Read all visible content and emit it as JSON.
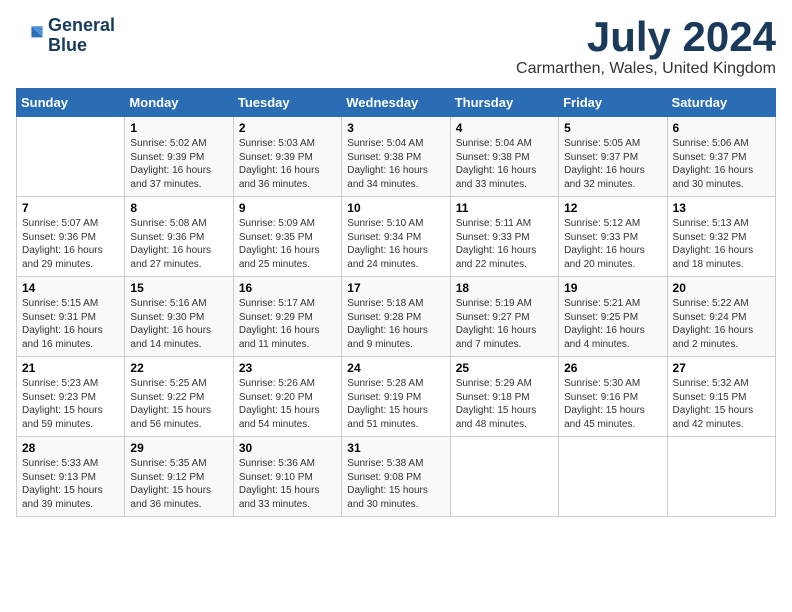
{
  "header": {
    "logo_line1": "General",
    "logo_line2": "Blue",
    "month": "July 2024",
    "location": "Carmarthen, Wales, United Kingdom"
  },
  "weekdays": [
    "Sunday",
    "Monday",
    "Tuesday",
    "Wednesday",
    "Thursday",
    "Friday",
    "Saturday"
  ],
  "weeks": [
    [
      {
        "day": "",
        "info": ""
      },
      {
        "day": "1",
        "info": "Sunrise: 5:02 AM\nSunset: 9:39 PM\nDaylight: 16 hours\nand 37 minutes."
      },
      {
        "day": "2",
        "info": "Sunrise: 5:03 AM\nSunset: 9:39 PM\nDaylight: 16 hours\nand 36 minutes."
      },
      {
        "day": "3",
        "info": "Sunrise: 5:04 AM\nSunset: 9:38 PM\nDaylight: 16 hours\nand 34 minutes."
      },
      {
        "day": "4",
        "info": "Sunrise: 5:04 AM\nSunset: 9:38 PM\nDaylight: 16 hours\nand 33 minutes."
      },
      {
        "day": "5",
        "info": "Sunrise: 5:05 AM\nSunset: 9:37 PM\nDaylight: 16 hours\nand 32 minutes."
      },
      {
        "day": "6",
        "info": "Sunrise: 5:06 AM\nSunset: 9:37 PM\nDaylight: 16 hours\nand 30 minutes."
      }
    ],
    [
      {
        "day": "7",
        "info": "Sunrise: 5:07 AM\nSunset: 9:36 PM\nDaylight: 16 hours\nand 29 minutes."
      },
      {
        "day": "8",
        "info": "Sunrise: 5:08 AM\nSunset: 9:36 PM\nDaylight: 16 hours\nand 27 minutes."
      },
      {
        "day": "9",
        "info": "Sunrise: 5:09 AM\nSunset: 9:35 PM\nDaylight: 16 hours\nand 25 minutes."
      },
      {
        "day": "10",
        "info": "Sunrise: 5:10 AM\nSunset: 9:34 PM\nDaylight: 16 hours\nand 24 minutes."
      },
      {
        "day": "11",
        "info": "Sunrise: 5:11 AM\nSunset: 9:33 PM\nDaylight: 16 hours\nand 22 minutes."
      },
      {
        "day": "12",
        "info": "Sunrise: 5:12 AM\nSunset: 9:33 PM\nDaylight: 16 hours\nand 20 minutes."
      },
      {
        "day": "13",
        "info": "Sunrise: 5:13 AM\nSunset: 9:32 PM\nDaylight: 16 hours\nand 18 minutes."
      }
    ],
    [
      {
        "day": "14",
        "info": "Sunrise: 5:15 AM\nSunset: 9:31 PM\nDaylight: 16 hours\nand 16 minutes."
      },
      {
        "day": "15",
        "info": "Sunrise: 5:16 AM\nSunset: 9:30 PM\nDaylight: 16 hours\nand 14 minutes."
      },
      {
        "day": "16",
        "info": "Sunrise: 5:17 AM\nSunset: 9:29 PM\nDaylight: 16 hours\nand 11 minutes."
      },
      {
        "day": "17",
        "info": "Sunrise: 5:18 AM\nSunset: 9:28 PM\nDaylight: 16 hours\nand 9 minutes."
      },
      {
        "day": "18",
        "info": "Sunrise: 5:19 AM\nSunset: 9:27 PM\nDaylight: 16 hours\nand 7 minutes."
      },
      {
        "day": "19",
        "info": "Sunrise: 5:21 AM\nSunset: 9:25 PM\nDaylight: 16 hours\nand 4 minutes."
      },
      {
        "day": "20",
        "info": "Sunrise: 5:22 AM\nSunset: 9:24 PM\nDaylight: 16 hours\nand 2 minutes."
      }
    ],
    [
      {
        "day": "21",
        "info": "Sunrise: 5:23 AM\nSunset: 9:23 PM\nDaylight: 15 hours\nand 59 minutes."
      },
      {
        "day": "22",
        "info": "Sunrise: 5:25 AM\nSunset: 9:22 PM\nDaylight: 15 hours\nand 56 minutes."
      },
      {
        "day": "23",
        "info": "Sunrise: 5:26 AM\nSunset: 9:20 PM\nDaylight: 15 hours\nand 54 minutes."
      },
      {
        "day": "24",
        "info": "Sunrise: 5:28 AM\nSunset: 9:19 PM\nDaylight: 15 hours\nand 51 minutes."
      },
      {
        "day": "25",
        "info": "Sunrise: 5:29 AM\nSunset: 9:18 PM\nDaylight: 15 hours\nand 48 minutes."
      },
      {
        "day": "26",
        "info": "Sunrise: 5:30 AM\nSunset: 9:16 PM\nDaylight: 15 hours\nand 45 minutes."
      },
      {
        "day": "27",
        "info": "Sunrise: 5:32 AM\nSunset: 9:15 PM\nDaylight: 15 hours\nand 42 minutes."
      }
    ],
    [
      {
        "day": "28",
        "info": "Sunrise: 5:33 AM\nSunset: 9:13 PM\nDaylight: 15 hours\nand 39 minutes."
      },
      {
        "day": "29",
        "info": "Sunrise: 5:35 AM\nSunset: 9:12 PM\nDaylight: 15 hours\nand 36 minutes."
      },
      {
        "day": "30",
        "info": "Sunrise: 5:36 AM\nSunset: 9:10 PM\nDaylight: 15 hours\nand 33 minutes."
      },
      {
        "day": "31",
        "info": "Sunrise: 5:38 AM\nSunset: 9:08 PM\nDaylight: 15 hours\nand 30 minutes."
      },
      {
        "day": "",
        "info": ""
      },
      {
        "day": "",
        "info": ""
      },
      {
        "day": "",
        "info": ""
      }
    ]
  ]
}
